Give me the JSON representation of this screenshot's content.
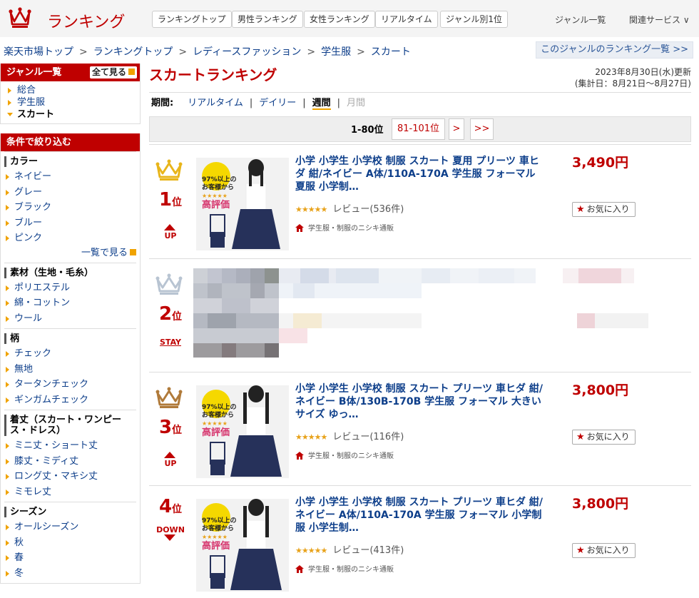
{
  "header": {
    "logo_text": "ランキング",
    "nav": [
      "ランキングトップ",
      "男性ランキング",
      "女性ランキング",
      "リアルタイム",
      "ジャンル別1位"
    ],
    "links": [
      "ジャンル一覧",
      "関連サービス ∨"
    ]
  },
  "breadcrumb": [
    "楽天市場トップ",
    "ランキングトップ",
    "レディースファッション",
    "学生服",
    "スカート"
  ],
  "genre_list_link": "このジャンルのランキング一覧 >>",
  "sidebar": {
    "genre_title": "ジャンル一覧",
    "see_all": "全て見る",
    "genres": [
      "総合",
      "学生服",
      "スカート"
    ],
    "filter_title": "条件で絞り込む",
    "sections": [
      {
        "title": "カラー",
        "items": [
          "ネイビー",
          "グレー",
          "ブラック",
          "ブルー",
          "ピンク"
        ],
        "more": "一覧で見る"
      },
      {
        "title": "素材（生地・毛糸）",
        "items": [
          "ポリエステル",
          "綿・コットン",
          "ウール"
        ]
      },
      {
        "title": "柄",
        "items": [
          "チェック",
          "無地",
          "タータンチェック",
          "ギンガムチェック"
        ]
      },
      {
        "title": "着丈（スカート・ワンピース・ドレス）",
        "items": [
          "ミニ丈・ショート丈",
          "膝丈・ミディ丈",
          "ロング丈・マキシ丈",
          "ミモレ丈"
        ]
      },
      {
        "title": "シーズン",
        "items": [
          "オールシーズン",
          "秋",
          "春",
          "冬"
        ]
      }
    ]
  },
  "main": {
    "title": "スカートランキング",
    "updated": "2023年8月30日(水)更新",
    "period_range": "(集計日：8月21日～8月27日)",
    "period_label": "期間:",
    "periods": [
      "リアルタイム",
      "デイリー",
      "週間",
      "月間"
    ],
    "pager": {
      "current": "1-80位",
      "next_range": "81-101位",
      "next": ">",
      "last": ">>"
    }
  },
  "items": [
    {
      "rank": "1",
      "rank_suffix": "位",
      "movement": "UP",
      "title": "小学 小学生 小学校 制服 スカート 夏用 プリーツ 車ヒダ 紺/ネイビー A体/110A-170A 学生服 フォーマル 夏服 小学制…",
      "stars": "★★★★★",
      "reviews": "レビュー(536件)",
      "shop": "学生服・制服のニシキ通販",
      "price": "3,490円",
      "fav": "お気に入り",
      "badge": {
        "line1": "97%以上の",
        "line2": "お客様から",
        "line3": "高評価"
      }
    },
    {
      "rank": "2",
      "rank_suffix": "位",
      "movement": "STAY"
    },
    {
      "rank": "3",
      "rank_suffix": "位",
      "movement": "UP",
      "title": "小学 小学生 小学校 制服 スカート プリーツ 車ヒダ 紺/ネイビー B体/130B-170B 学生服 フォーマル 大きいサイズ ゆっ…",
      "stars": "★★★★★",
      "reviews": "レビュー(116件)",
      "shop": "学生服・制服のニシキ通販",
      "price": "3,800円",
      "fav": "お気に入り",
      "badge": {
        "line1": "97%以上の",
        "line2": "お客様から",
        "line3": "高評価"
      }
    },
    {
      "rank": "4",
      "rank_suffix": "位",
      "movement": "DOWN",
      "title": "小学 小学生 小学校 制服 スカート プリーツ 車ヒダ 紺/ネイビー A体/110A-170A 学生服 フォーマル 小学制服 小学生制…",
      "stars": "★★★★★",
      "reviews": "レビュー(413件)",
      "shop": "学生服・制服のニシキ通販",
      "price": "3,800円",
      "fav": "お気に入り",
      "badge": {
        "line1": "97%以上の",
        "line2": "お客様から",
        "line3": "高評価"
      }
    }
  ],
  "colors": {
    "brand_red": "#bf0000",
    "link_blue": "#0d3e8a",
    "accent_orange": "#f0a300",
    "gold": "#e8b51a",
    "silver": "#b8c4d2",
    "bronze": "#b07a3a"
  }
}
